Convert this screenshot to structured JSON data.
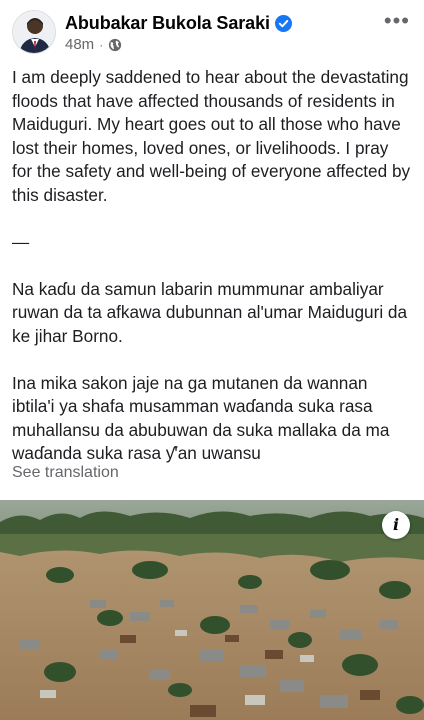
{
  "post": {
    "author": "Abubakar Bukola Saraki",
    "verified": true,
    "time": "48m",
    "separator": "·",
    "audience_icon": "globe-icon",
    "more_label": "•••",
    "paragraphs": [
      "I am deeply saddened to hear about the devastating floods that have affected thousands of residents in Maiduguri. My heart goes out to all those who have lost their homes, loved ones, or livelihoods. I pray for the safety and well-being of everyone affected by this disaster.",
      "—",
      "Na kaɗu da samun labarin mummunar ambaliyar ruwan da ta afkawa dubunnan al'umar Maiduguri da ke jihar Borno.",
      "Ina mika sakon jaje na ga mutanen da wannan ibtila'i ya shafa musamman waɗanda suka rasa muhallansu da abubuwan da suka mallaka da ma waɗanda suka rasa ƴ'an uwansu"
    ],
    "see_translation": "See translation",
    "photo_info_label": "i"
  },
  "colors": {
    "verified_blue": "#1877f2",
    "secondary_text": "#65676b",
    "flood_water": "#a68a6a"
  }
}
